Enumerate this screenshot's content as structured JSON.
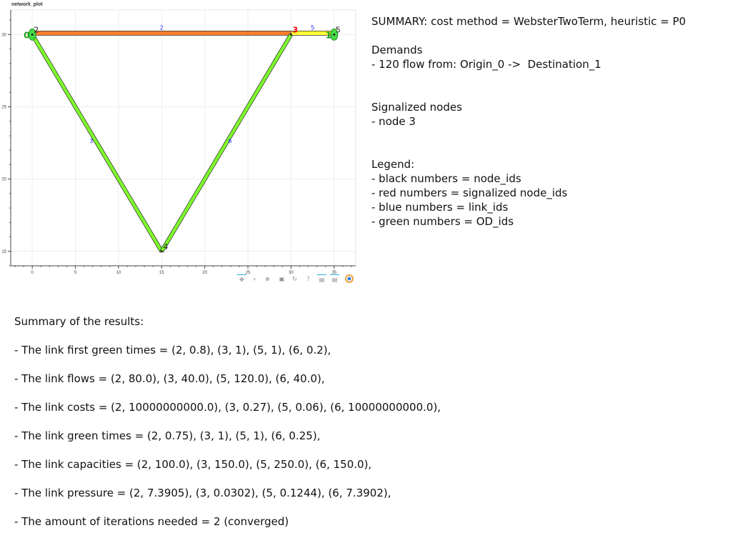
{
  "plot": {
    "title": "network_plot",
    "x_axis": {
      "range": [
        -2.5,
        37.5
      ],
      "ticks": [
        0,
        5,
        10,
        15,
        20,
        25,
        30,
        35
      ]
    },
    "y_axis": {
      "range": [
        14.0,
        31.7
      ],
      "ticks": [
        15,
        20,
        25,
        30
      ]
    },
    "nodes": [
      {
        "id": "0",
        "x": 0,
        "y": 30,
        "color": "#222222",
        "kind": "od",
        "od_label": "0"
      },
      {
        "id": "1",
        "x": 35,
        "y": 30,
        "color": "#222222",
        "kind": "od",
        "od_label": "1"
      },
      {
        "id": "2",
        "x": 0,
        "y": 30,
        "color": "#222222",
        "kind": "node"
      },
      {
        "id": "3",
        "x": 30,
        "y": 30,
        "color": "#ff0000",
        "kind": "signal"
      },
      {
        "id": "4",
        "x": 15,
        "y": 15,
        "color": "#222222",
        "kind": "node"
      },
      {
        "id": "5",
        "x": 35,
        "y": 30,
        "color": "#222222",
        "kind": "node"
      }
    ],
    "links": [
      {
        "id": "2",
        "from": [
          0,
          30
        ],
        "to": [
          30,
          30
        ],
        "color": "#ff7f2a"
      },
      {
        "id": "3",
        "from": [
          0,
          30
        ],
        "to": [
          15,
          15
        ],
        "color": "#7fff2a"
      },
      {
        "id": "5",
        "from": [
          30,
          30
        ],
        "to": [
          35,
          30
        ],
        "color": "#ffff33"
      },
      {
        "id": "6",
        "from": [
          15,
          15
        ],
        "to": [
          30,
          30
        ],
        "color": "#7fff2a"
      }
    ],
    "toolbar": [
      "pan-icon",
      "box-zoom-icon",
      "wheel-zoom-icon",
      "save-icon",
      "reset-icon",
      "help-icon",
      "hover-icon",
      "hover-icon-2",
      "bokeh-logo-icon"
    ]
  },
  "summary": {
    "line1": "SUMMARY: cost method = WebsterTwoTerm, heuristic = P0",
    "demands_title": "Demands",
    "demand_1": "- 120 flow from: Origin_0 ->  Destination_1",
    "signalized_title": "Signalized nodes",
    "signalized_1": "- node 3",
    "legend_title": "Legend:",
    "legend_1": "- black numbers = node_ids",
    "legend_2": "- red numbers = signalized node_ids",
    "legend_3": "- blue numbers = link_ids",
    "legend_4": "- green numbers = OD_ids"
  },
  "results": {
    "title": "Summary of the results:",
    "first_green": "- The link first green times = (2, 0.8), (3, 1), (5, 1), (6, 0.2),",
    "flows": "- The link flows = (2, 80.0), (3, 40.0), (5, 120.0), (6, 40.0),",
    "costs": "- The link costs = (2, 10000000000.0), (3, 0.27), (5, 0.06), (6, 10000000000.0),",
    "green_times": "- The link green times = (2, 0.75), (3, 1), (5, 1), (6, 0.25),",
    "capacities": "- The link capacities = (2, 100.0), (3, 150.0), (5, 250.0), (6, 150.0),",
    "pressure": "- The link pressure = (2, 7.3905), (3, 0.0302), (5, 0.1244), (6, 7.3902),",
    "iterations": "- The amount of iterations needed = 2 (converged)"
  }
}
